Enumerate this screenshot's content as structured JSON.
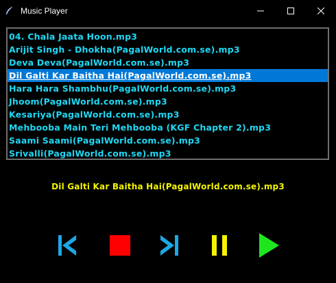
{
  "window": {
    "title": "Music Player",
    "icon": "feather-icon",
    "controls": [
      "minimize-icon",
      "maximize-icon",
      "close-icon"
    ]
  },
  "playlist": {
    "songs": [
      "04. Chala Jaata Hoon.mp3",
      "Arijit Singh - Dhokha(PagalWorld.com.se).mp3",
      "Deva Deva(PagalWorld.com.se).mp3",
      "Dil Galti Kar Baitha Hai(PagalWorld.com.se).mp3",
      "Hara Hara Shambhu(PagalWorld.com.se).mp3",
      "Jhoom(PagalWorld.com.se).mp3",
      "Kesariya(PagalWorld.com.se).mp3",
      "Mehbooba Main Teri Mehbooba (KGF Chapter 2).mp3",
      "Saami Saami(PagalWorld.com.se).mp3",
      "Srivalli(PagalWorld.com.se).mp3"
    ],
    "selected_index": 3
  },
  "now_playing": "Dil Galti Kar Baitha Hai(PagalWorld.com.se).mp3",
  "colors": {
    "background": "#000000",
    "song_text": "#1fd7f3",
    "selection": "#0078d7",
    "now_playing": "#f4f400",
    "prev": "#1ca8e6",
    "stop": "#ff0000",
    "next": "#1ca8e6",
    "pause": "#f4f400",
    "play": "#1ee61e"
  },
  "buttons": [
    {
      "name": "previous-button",
      "icon": "skip-previous-icon"
    },
    {
      "name": "stop-button",
      "icon": "stop-icon"
    },
    {
      "name": "next-button",
      "icon": "skip-next-icon"
    },
    {
      "name": "pause-button",
      "icon": "pause-icon"
    },
    {
      "name": "play-button",
      "icon": "play-icon"
    }
  ]
}
